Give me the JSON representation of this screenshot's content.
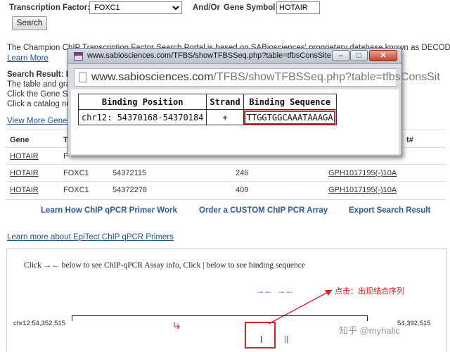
{
  "form": {
    "tf_label": "Transcription Factor:",
    "tf_value": "FOXC1",
    "andor_label": "And/Or",
    "gene_label": "Gene Symbol:",
    "gene_value": "HOTAIR",
    "search_button": "Search"
  },
  "intro": {
    "line1": "The Champion ChIP Transcription Factor Search Portal is based on SABiosciences' proprietary database known as DECODE.",
    "learn_more": "Learn More"
  },
  "result_info": {
    "heading": "Search Result: F",
    "line1": "The table and gra",
    "line2": "Click the Gene Sy",
    "line3": "Click a catalog nu",
    "view_more": "View More Genes"
  },
  "table": {
    "headers": {
      "gene": "Gene",
      "tf": "T",
      "catalog": "t#"
    },
    "rows": [
      {
        "gene": "HOTAIR",
        "tf": "F",
        "position": "",
        "distance": "",
        "catalog": ""
      },
      {
        "gene": "HOTAIR",
        "tf": "FOXC1",
        "position": "54372115",
        "distance": "246",
        "catalog": "GPH1017195(-)10A"
      },
      {
        "gene": "HOTAIR",
        "tf": "FOXC1",
        "position": "54372278",
        "distance": "409",
        "catalog": "GPH1017195(-)10A"
      }
    ]
  },
  "actions": {
    "learn_primer": "Learn How ChIP qPCR Primer Work",
    "order_array": "Order a CUSTOM ChIP PCR Array",
    "export": "Export Search Result"
  },
  "epitect_link": "Learn more about EpiTect ChIP qPCR Primers",
  "popup": {
    "title": "www.sabiosciences.com/TFBS/showTFBSSeq.php?table=tfbsConsSite...",
    "url_host": "www.sabiosciences.com",
    "url_path": "/TFBS/showTFBSSeq.php?table=tfbsConsSit",
    "headers": [
      "Binding Position",
      "Strand",
      "Binding Sequence"
    ],
    "row": {
      "position": "chr12: 54370168-54370184",
      "strand": "+",
      "sequence": "TTGGTGGCAAATAAAGA"
    }
  },
  "browser": {
    "instruction_a": "Click",
    "instruction_b": "below to see ChIP-qPCR Assay info,  Click |  below to see binding sequence",
    "annotation": "点击：出现结合序列",
    "start": "chr12:54,352,515",
    "end": "54,392,515",
    "watermark": "知乎 @myhalic"
  },
  "colors": {
    "link": "#23508a",
    "accent_red": "#e02020",
    "arrow_blue": "#1f2fa8",
    "green_mark": "#2e9a2e"
  }
}
